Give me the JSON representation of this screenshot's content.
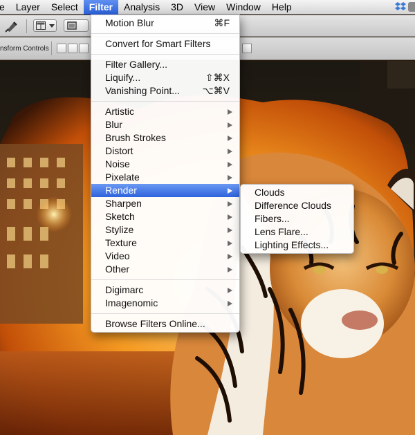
{
  "menubar": {
    "items": [
      "e",
      "Layer",
      "Select",
      "Filter",
      "Analysis",
      "3D",
      "View",
      "Window",
      "Help"
    ],
    "active": "Filter",
    "active_color": "#3a6ee0"
  },
  "toolbar": {
    "transform_label": "nsform Controls"
  },
  "filter_menu": {
    "motion_blur": "Motion Blur",
    "motion_blur_shortcut": "⌘F",
    "convert_smart": "Convert for Smart Filters",
    "filter_gallery": "Filter Gallery...",
    "liquify": "Liquify...",
    "liquify_shortcut": "⇧⌘X",
    "vanishing_point": "Vanishing Point...",
    "vanishing_point_shortcut": "⌥⌘V",
    "artistic": "Artistic",
    "blur": "Blur",
    "brush_strokes": "Brush Strokes",
    "distort": "Distort",
    "noise": "Noise",
    "pixelate": "Pixelate",
    "render": "Render",
    "sharpen": "Sharpen",
    "sketch": "Sketch",
    "stylize": "Stylize",
    "texture": "Texture",
    "video": "Video",
    "other": "Other",
    "digimarc": "Digimarc",
    "imagenomic": "Imagenomic",
    "browse_online": "Browse Filters Online..."
  },
  "render_submenu": {
    "items": [
      "Clouds",
      "Difference Clouds",
      "Fibers...",
      "Lens Flare...",
      "Lighting Effects..."
    ]
  },
  "icons": {
    "arrow": "submenu-arrow-icon",
    "tool": "move-tool-icon"
  }
}
